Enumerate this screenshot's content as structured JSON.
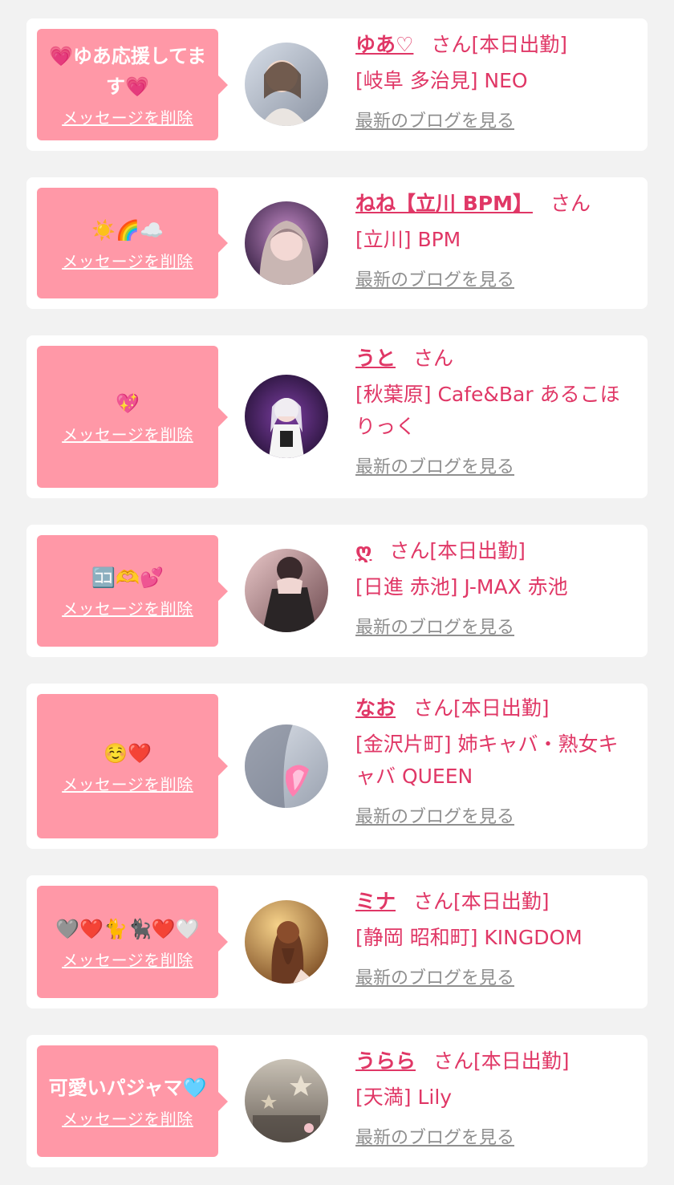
{
  "entries": [
    {
      "message": "💗ゆあ応援してます💗",
      "delete_label": "メッセージを削除",
      "name": "ゆあ♡",
      "honorific": "さん",
      "status": "[本日出勤]",
      "shop": "[岐阜 多治見] NEO",
      "blog_label": "最新のブログを見る"
    },
    {
      "message": "☀️🌈☁️",
      "delete_label": "メッセージを削除",
      "name": "ねね【立川 BPM】",
      "honorific": "さん",
      "status": "",
      "shop": "[立川] BPM",
      "blog_label": "最新のブログを見る"
    },
    {
      "message": "💖",
      "delete_label": "メッセージを削除",
      "name": "うと",
      "honorific": "さん",
      "status": "",
      "shop": "[秋葉原] Cafe&Bar あるこほりっく",
      "blog_label": "最新のブログを見る"
    },
    {
      "message": "🈁🫶💕",
      "delete_label": "メッセージを削除",
      "name": "ღ",
      "honorific": "さん",
      "status": "[本日出勤]",
      "shop": "[日進 赤池] J-MAX 赤池",
      "blog_label": "最新のブログを見る"
    },
    {
      "message": "☺️❤️",
      "delete_label": "メッセージを削除",
      "name": "なお",
      "honorific": "さん",
      "status": "[本日出勤]",
      "shop": "[金沢片町] 姉キャバ・熟女キャバ QUEEN",
      "blog_label": "最新のブログを見る"
    },
    {
      "message": "🩶❤️🐈🐈‍⬛❤️🤍",
      "delete_label": "メッセージを削除",
      "name": "ミナ",
      "honorific": "さん",
      "status": "[本日出勤]",
      "shop": "[静岡 昭和町] KINGDOM",
      "blog_label": "最新のブログを見る"
    },
    {
      "message": "可愛いパジャマ🩵",
      "delete_label": "メッセージを削除",
      "name": "うらら",
      "honorific": "さん",
      "status": "[本日出勤]",
      "shop": "[天満] Lily",
      "blog_label": "最新のブログを見る"
    }
  ],
  "colors": {
    "background": "#f2f2f2",
    "bubble": "#ff98a7",
    "accent": "#e03766",
    "muted": "#8f8f8f"
  }
}
